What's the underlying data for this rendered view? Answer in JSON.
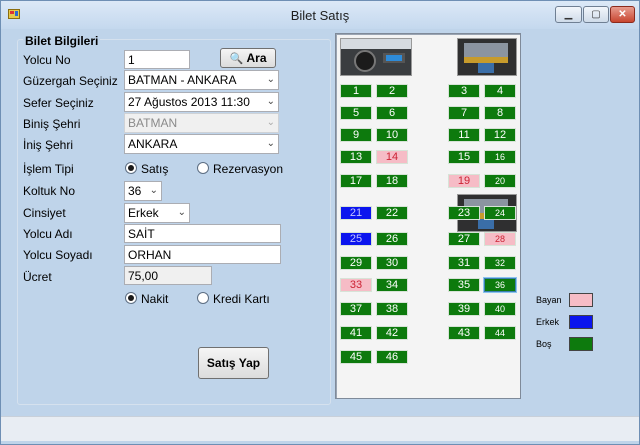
{
  "window": {
    "title": "Bilet Satış"
  },
  "group": {
    "title": "Bilet Bilgileri"
  },
  "form": {
    "yolcu_no_label": "Yolcu No",
    "yolcu_no_value": "1",
    "ara_label": "Ara",
    "guzergah_label": "Güzergah Seçiniz",
    "guzergah_value": "BATMAN - ANKARA",
    "sefer_label": "Sefer Seçiniz",
    "sefer_value": "27 Ağustos 2013 11:30",
    "binis_label": "Biniş Şehri",
    "binis_value": "BATMAN",
    "inis_label": "İniş Şehri",
    "inis_value": "ANKARA",
    "islem_label": "İşlem Tipi",
    "islem_opt1": "Satış",
    "islem_opt2": "Rezervasyon",
    "koltuk_label": "Koltuk No",
    "koltuk_value": "36",
    "cinsiyet_label": "Cinsiyet",
    "cinsiyet_value": "Erkek",
    "ad_label": "Yolcu Adı",
    "ad_value": "SAİT",
    "soyad_label": "Yolcu Soyadı",
    "soyad_value": "ORHAN",
    "ucret_label": "Ücret",
    "ucret_value": "75,00",
    "odeme_opt1": "Nakit",
    "odeme_opt2": "Kredi Kartı",
    "satis_button": "Satış Yap"
  },
  "seats": [
    {
      "no": "1",
      "status": "empty"
    },
    {
      "no": "2",
      "status": "empty"
    },
    {
      "no": "3",
      "status": "empty"
    },
    {
      "no": "4",
      "status": "empty"
    },
    {
      "no": "5",
      "status": "empty"
    },
    {
      "no": "6",
      "status": "empty"
    },
    {
      "no": "7",
      "status": "empty"
    },
    {
      "no": "8",
      "status": "empty"
    },
    {
      "no": "9",
      "status": "empty"
    },
    {
      "no": "10",
      "status": "empty"
    },
    {
      "no": "11",
      "status": "empty"
    },
    {
      "no": "12",
      "status": "empty"
    },
    {
      "no": "13",
      "status": "empty"
    },
    {
      "no": "14",
      "status": "female"
    },
    {
      "no": "15",
      "status": "empty"
    },
    {
      "no": "16",
      "status": "empty"
    },
    {
      "no": "17",
      "status": "empty"
    },
    {
      "no": "18",
      "status": "empty"
    },
    {
      "no": "19",
      "status": "female"
    },
    {
      "no": "20",
      "status": "empty"
    },
    {
      "no": "21",
      "status": "male"
    },
    {
      "no": "22",
      "status": "empty"
    },
    {
      "no": "23",
      "status": "empty"
    },
    {
      "no": "24",
      "status": "empty"
    },
    {
      "no": "25",
      "status": "male"
    },
    {
      "no": "26",
      "status": "empty"
    },
    {
      "no": "27",
      "status": "empty"
    },
    {
      "no": "28",
      "status": "female"
    },
    {
      "no": "29",
      "status": "empty"
    },
    {
      "no": "30",
      "status": "empty"
    },
    {
      "no": "31",
      "status": "empty"
    },
    {
      "no": "32",
      "status": "empty"
    },
    {
      "no": "33",
      "status": "female"
    },
    {
      "no": "34",
      "status": "empty"
    },
    {
      "no": "35",
      "status": "empty"
    },
    {
      "no": "36",
      "status": "selected"
    },
    {
      "no": "37",
      "status": "empty"
    },
    {
      "no": "38",
      "status": "empty"
    },
    {
      "no": "39",
      "status": "empty"
    },
    {
      "no": "40",
      "status": "empty"
    },
    {
      "no": "41",
      "status": "empty"
    },
    {
      "no": "42",
      "status": "empty"
    },
    {
      "no": "43",
      "status": "empty"
    },
    {
      "no": "44",
      "status": "empty"
    },
    {
      "no": "45",
      "status": "empty"
    },
    {
      "no": "46",
      "status": "empty"
    }
  ],
  "legend": [
    {
      "label": "Bayan",
      "color": "#f6bcc6"
    },
    {
      "label": "Erkek",
      "color": "#0b15ee"
    },
    {
      "label": "Boş",
      "color": "#0d7a0d"
    }
  ],
  "colors": {
    "empty": "#0d7a0d",
    "female": "#f6bcc6",
    "male": "#0b15ee"
  }
}
